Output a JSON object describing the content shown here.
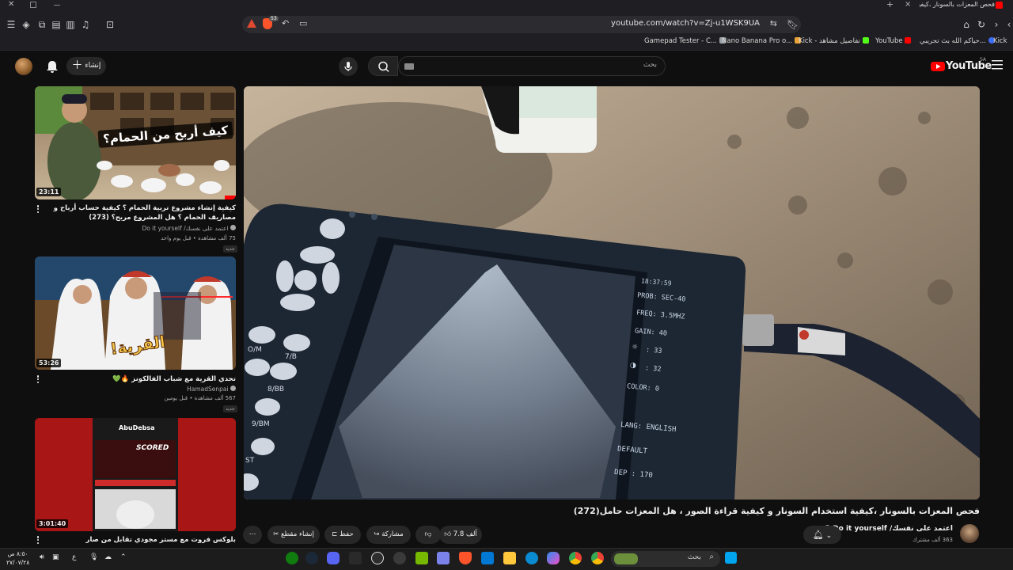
{
  "browser": {
    "tab_title": "فحص المعزات بالسونار ،كيفية",
    "url": "youtube.com/watch?v=Zj-u1WSK9UA",
    "badge_count": "53",
    "bookmarks": [
      {
        "label": "Gamepad Tester - C...",
        "color": "#9aa0a6"
      },
      {
        "label": "Nano Banana Pro o...",
        "color": "#e8a23a"
      },
      {
        "label": "Kick - تفاصيل مشاهد",
        "color": "#53fc18"
      },
      {
        "label": "YouTube",
        "color": "#ff0000"
      },
      {
        "label": "حياكم الله بث تجريبي...",
        "color": "#3b6cf6"
      },
      {
        "label": "Kick",
        "color": "#53fc18"
      }
    ]
  },
  "header": {
    "search_placeholder": "بحث",
    "create_label": "إنشاء",
    "logo_text": "YouTube",
    "logo_region": "SA"
  },
  "recommendations": [
    {
      "title": "كيفية إنشاء مشروع تربية الحمام ؟ كيفية حساب أرباح و مصاريف الحمام ؟ هل المشروع مربح؟ (273)",
      "channel": "اعتمد على نفسك/ Do it yourself",
      "meta": "75 ألف مشاهدة • قبل يوم واحد",
      "duration": "23:11",
      "thumb_text": "كيف أربح من الحمام؟",
      "new_badge": "جديد"
    },
    {
      "title": "تحدي القرية مع شباب الفالكونز 🔥💚",
      "channel": "HamadSenpai",
      "meta": "567 ألف مشاهدة • قبل يومين",
      "duration": "53:26",
      "thumb_text": "القرية!",
      "new_badge": "جديد"
    },
    {
      "title": "بلوكس فروت مع مستر مجودي تقابل من صار",
      "channel": "",
      "meta": "",
      "duration": "3:01:40",
      "thumb_text": "AbuDebsa",
      "thumb_subtext": "SCORED"
    }
  ],
  "video": {
    "title": "فحص المعزات بالسونار ،كيفية استخدام السونار و كيفية قراءة الصور ، هل المعزات حامل(272)",
    "channel": "اعتمد على نفسك/ Do it yourself",
    "subscribers": "363 ألف مشترك",
    "likes": "7.8 ألف",
    "share_label": "مشاركة",
    "save_label": "حفظ",
    "clip_label": "إنشاء مقطع",
    "screen": {
      "time": "18:37:59",
      "prob": "PROB: SEC-40",
      "freq": "FREQ: 3.5MHZ",
      "gain": "GAIN: 40",
      "v33": ": 33",
      "v32": ": 32",
      "color": "COLOR: 0",
      "lang": "LANG: ENGLISH",
      "def": "DEFAULT",
      "dep": "DEP : 170"
    },
    "keypad": [
      "O/M",
      "7/B",
      "8/BB",
      "9/BM",
      "ST"
    ]
  },
  "taskbar": {
    "search_label": "بحث",
    "time": "٨:٥٠ ص",
    "date": "٢٧/٠٧/٢٨",
    "lang": "ع",
    "app_colors": [
      "#4cc2ff",
      "#e8e8e8",
      "#5865f2",
      "#111111",
      "#cfcfcf",
      "#76b900",
      "#7b83eb",
      "#fb542b",
      "#0078d4",
      "#ffc83d",
      "#0b8bd1",
      "#00a4ef",
      "#34a853"
    ]
  },
  "colors": {
    "accent": "#ff0000",
    "background": "#0f0f0f",
    "chip": "#272727"
  }
}
